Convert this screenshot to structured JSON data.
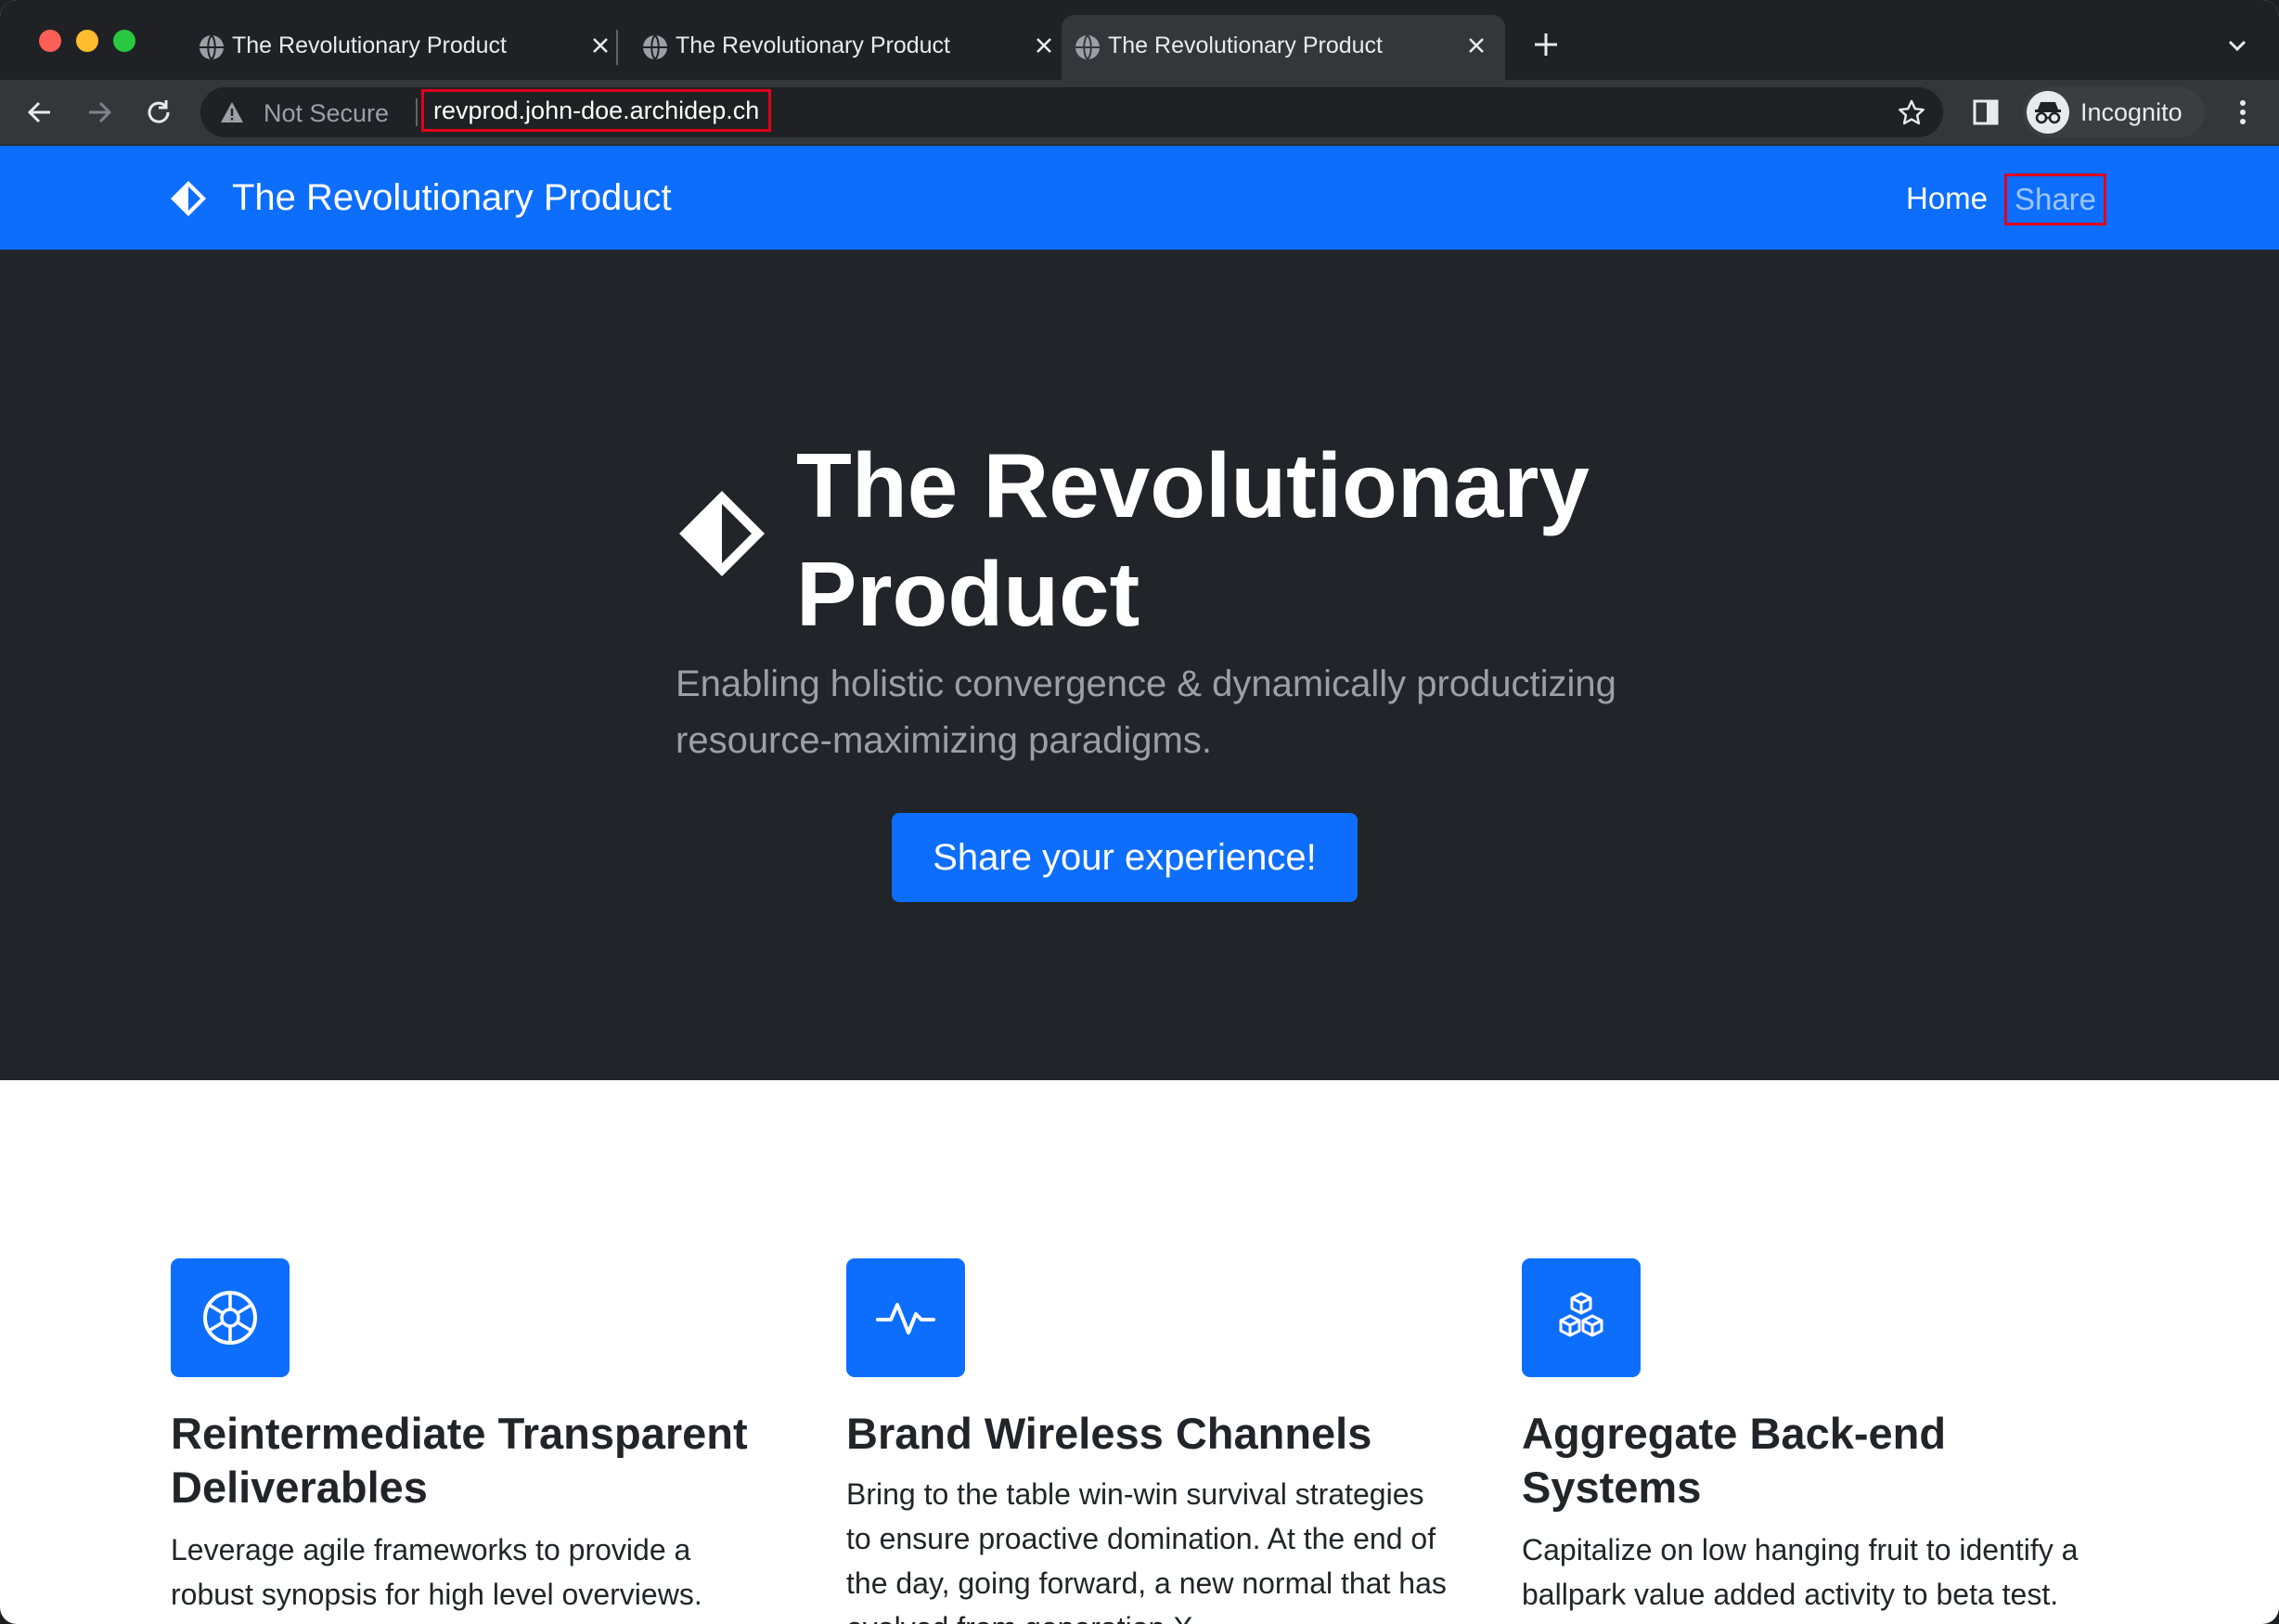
{
  "browser": {
    "tabs": [
      {
        "title": "The Revolutionary Product",
        "active": false
      },
      {
        "title": "The Revolutionary Product",
        "active": false
      },
      {
        "title": "The Revolutionary Product",
        "active": true
      }
    ],
    "security_label": "Not Secure",
    "url": "revprod.john-doe.archidep.ch",
    "profile_label": "Incognito"
  },
  "navbar": {
    "brand": "The Revolutionary Product",
    "links": {
      "home": "Home",
      "share": "Share"
    }
  },
  "hero": {
    "title": "The Revolutionary Product",
    "lead": "Enabling holistic convergence & dynamically productizing resource-maximizing paradigms.",
    "cta": "Share your experience!"
  },
  "features": [
    {
      "icon": "aperture-icon",
      "title": "Reintermediate Transparent Deliverables",
      "text": "Leverage agile frameworks to provide a robust synopsis for high level overviews."
    },
    {
      "icon": "activity-icon",
      "title": "Brand Wireless Channels",
      "text": "Bring to the table win-win survival strategies to ensure proactive domination. At the end of the day, going forward, a new normal that has evolved from generation X"
    },
    {
      "icon": "boxes-icon",
      "title": "Aggregate Back-end Systems",
      "text": "Capitalize on low hanging fruit to identify a ballpark value added activity to beta test."
    }
  ],
  "colors": {
    "primary": "#0d6efd",
    "hero_bg": "#212529",
    "highlight_box": "#e0001a"
  }
}
